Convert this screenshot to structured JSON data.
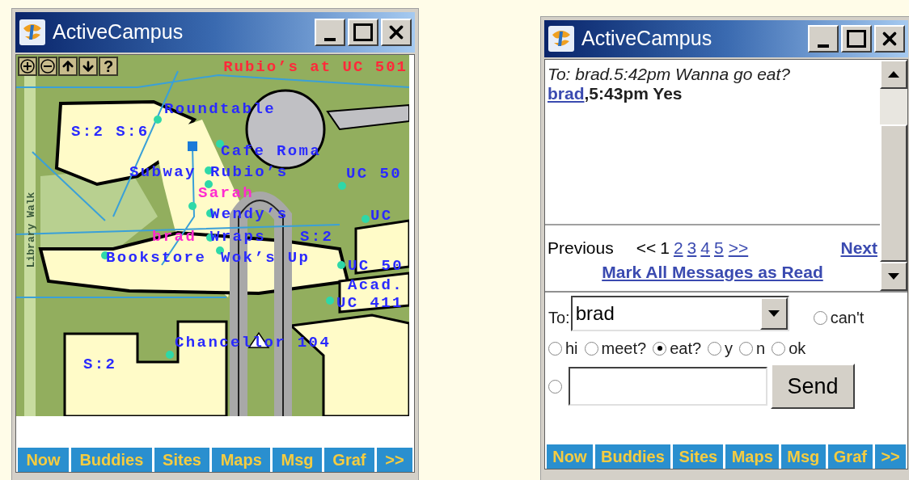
{
  "left_window": {
    "title": "ActiveCampus",
    "map": {
      "toolbar": [
        {
          "kind": "zoom-in"
        },
        {
          "kind": "zoom-out"
        },
        {
          "kind": "up"
        },
        {
          "kind": "down"
        },
        {
          "kind": "help",
          "label": "?"
        }
      ],
      "title": "Rubio’s at UC 501",
      "labels": [
        {
          "text": "Roundtable",
          "kind": "place"
        },
        {
          "text": "S:2 S:6",
          "kind": "place"
        },
        {
          "text": "Cafe Roma",
          "kind": "place"
        },
        {
          "text": "Subway",
          "kind": "place"
        },
        {
          "text": "Rubio’s",
          "kind": "place"
        },
        {
          "text": "UC 50",
          "kind": "place"
        },
        {
          "text": "Sarah",
          "kind": "person"
        },
        {
          "text": "Wendy’s",
          "kind": "place"
        },
        {
          "text": "UC",
          "kind": "place"
        },
        {
          "text": "brad",
          "kind": "person"
        },
        {
          "text": "Wraps",
          "kind": "place"
        },
        {
          "text": "S:2",
          "kind": "place"
        },
        {
          "text": "Bookstore",
          "kind": "place"
        },
        {
          "text": "Wok’s Up",
          "kind": "place"
        },
        {
          "text": "UC 50",
          "kind": "place"
        },
        {
          "text": "Acad.",
          "kind": "place"
        },
        {
          "text": "UC 411",
          "kind": "place"
        },
        {
          "text": "Chancellor 104",
          "kind": "place"
        },
        {
          "text": "S:2",
          "kind": "place"
        },
        {
          "text": "Library Walk",
          "kind": "street"
        }
      ]
    },
    "nav": [
      "Now",
      "Buddies",
      "Sites",
      "Maps",
      "Msg",
      "Graf",
      ">>"
    ]
  },
  "right_window": {
    "title": "ActiveCampus",
    "messages": [
      {
        "kind": "sent",
        "text": "To: brad.5:42pm Wanna go eat?"
      },
      {
        "kind": "received",
        "sender": "brad",
        "text": ",5:43pm Yes"
      }
    ],
    "pagination": {
      "previous": {
        "label": "Previous",
        "disabled": true
      },
      "first": {
        "label": "<<",
        "disabled": true
      },
      "pages": [
        {
          "label": "1",
          "selected": true
        },
        {
          "label": "2",
          "selected": false
        },
        {
          "label": "3",
          "selected": false
        },
        {
          "label": "4",
          "selected": false
        },
        {
          "label": "5",
          "selected": false
        }
      ],
      "last": {
        "label": ">>",
        "disabled": false
      },
      "next": {
        "label": "Next",
        "disabled": false
      }
    },
    "mark_all": "Mark All Messages as Read",
    "form": {
      "to_label": "To:",
      "recipient": "brad",
      "cant": {
        "label": "can't",
        "selected": false
      },
      "replies": [
        {
          "label": "hi",
          "selected": false
        },
        {
          "label": "meet?",
          "selected": false
        },
        {
          "label": "eat?",
          "selected": true
        },
        {
          "label": "y",
          "selected": false
        },
        {
          "label": "n",
          "selected": false
        },
        {
          "label": "ok",
          "selected": false
        }
      ],
      "custom": {
        "selected": false
      },
      "send": "Send"
    },
    "nav": [
      "Now",
      "Buddies",
      "Sites",
      "Maps",
      "Msg",
      "Graf",
      ">>"
    ]
  }
}
